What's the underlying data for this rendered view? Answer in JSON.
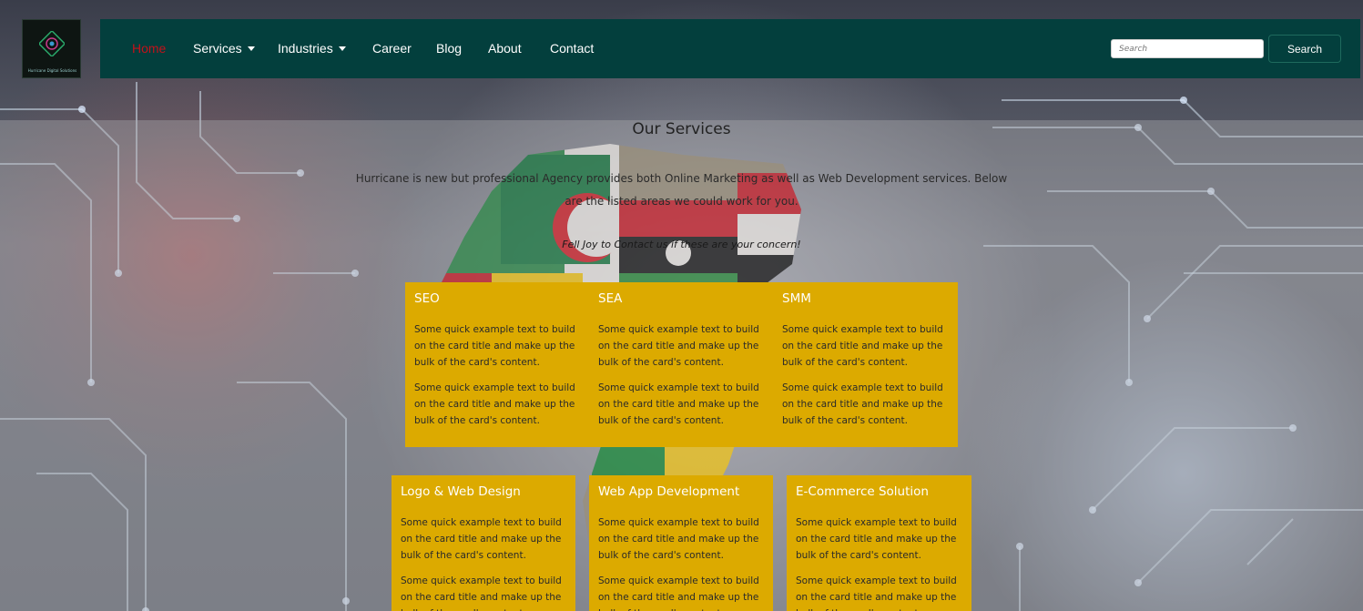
{
  "brand": {
    "logo_text": "Hurricane Digital Solutions"
  },
  "nav": {
    "items": [
      {
        "label": "Home",
        "active": true,
        "dropdown": false
      },
      {
        "label": "Services",
        "active": false,
        "dropdown": true
      },
      {
        "label": "Industries",
        "active": false,
        "dropdown": true
      },
      {
        "label": "Career",
        "active": false,
        "dropdown": false
      },
      {
        "label": "Blog",
        "active": false,
        "dropdown": false
      },
      {
        "label": "About",
        "active": false,
        "dropdown": false
      },
      {
        "label": "Contact",
        "active": false,
        "dropdown": false
      }
    ],
    "search_placeholder": "Search",
    "search_button": "Search"
  },
  "main": {
    "title": "Our Services",
    "intro": "Hurricane is new but professional Agency provides both Online Marketing as well as Web Development services. Below are the listed areas we could work for you.",
    "tagline": "Fell Joy to Contact us if these are your concern!",
    "cards": [
      {
        "title": "SEO",
        "text1": "Some quick example text to build on the card title and make up the bulk of the card's content.",
        "text2": "Some quick example text to build on the card title and make up the bulk of the card's content."
      },
      {
        "title": "SEA",
        "text1": "Some quick example text to build on the card title and make up the bulk of the card's content.",
        "text2": "Some quick example text to build on the card title and make up the bulk of the card's content."
      },
      {
        "title": "SMM",
        "text1": "Some quick example text to build on the card title and make up the bulk of the card's content.",
        "text2": "Some quick example text to build on the card title and make up the bulk of the card's content."
      },
      {
        "title": "Logo & Web Design",
        "text1": "Some quick example text to build on the card title and make up the bulk of the card's content.",
        "text2": "Some quick example text to build on the card title and make up the bulk of the card's content."
      },
      {
        "title": "Web App Development",
        "text1": "Some quick example text to build on the card title and make up the bulk of the card's content.",
        "text2": "Some quick example text to build on the card title and make up the bulk of the card's content."
      },
      {
        "title": "E-Commerce Solution",
        "text1": "Some quick example text to build on the card title and make up the bulk of the card's content.",
        "text2": "Some quick example text to build on the card title and make up the bulk of the card's content."
      }
    ]
  },
  "colors": {
    "navbar": "#033f3d",
    "active_nav": "#c4121a",
    "card": "#dcaa00"
  }
}
